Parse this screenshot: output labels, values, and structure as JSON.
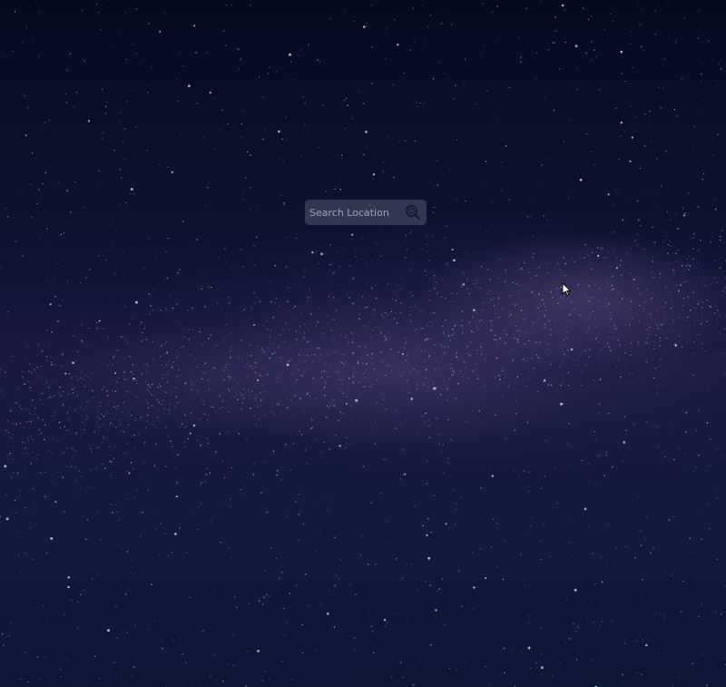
{
  "search": {
    "placeholder": "Search Location",
    "value": "",
    "icon": "search-icon"
  },
  "background": {
    "description_icon": "starry-night-background"
  },
  "pointer": {
    "icon": "mouse-cursor-icon"
  },
  "colors": {
    "sky_top": "#060b1c",
    "sky_mid": "#1a1a40",
    "milky_way": "#7a5a96",
    "search_box": "#6e748c",
    "search_text": "#9ea2b4"
  }
}
